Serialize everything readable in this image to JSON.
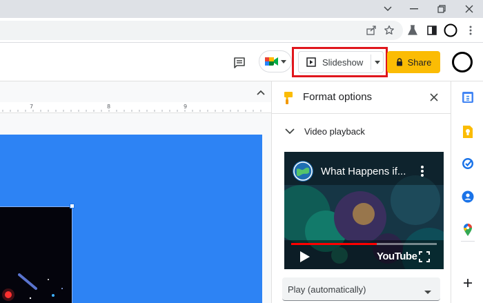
{
  "toolbar": {
    "slideshow_label": "Slideshow",
    "share_label": "Share"
  },
  "ruler": {
    "marks": [
      "7",
      "8",
      "9"
    ]
  },
  "panel": {
    "title": "Format options",
    "section_title": "Video playback",
    "video": {
      "title": "What Happens if...",
      "brand": "YouTube",
      "progress_fraction": 0.59
    },
    "play_mode": "Play (automatically)"
  },
  "colors": {
    "accent": "#2d83f4",
    "share": "#fbbc04",
    "highlight": "#e0161c",
    "progress": "#ff0000"
  },
  "icons": {
    "window": [
      "chevron-down-icon",
      "minimize-icon",
      "restore-icon",
      "close-icon"
    ],
    "address": [
      "share-page-icon",
      "star-icon",
      "labs-icon",
      "side-panel-icon",
      "profile-icon",
      "more-vert-icon"
    ],
    "sidebar": [
      "calendar-icon",
      "keep-icon",
      "tasks-icon",
      "contacts-icon",
      "maps-icon",
      "add-icon"
    ]
  }
}
